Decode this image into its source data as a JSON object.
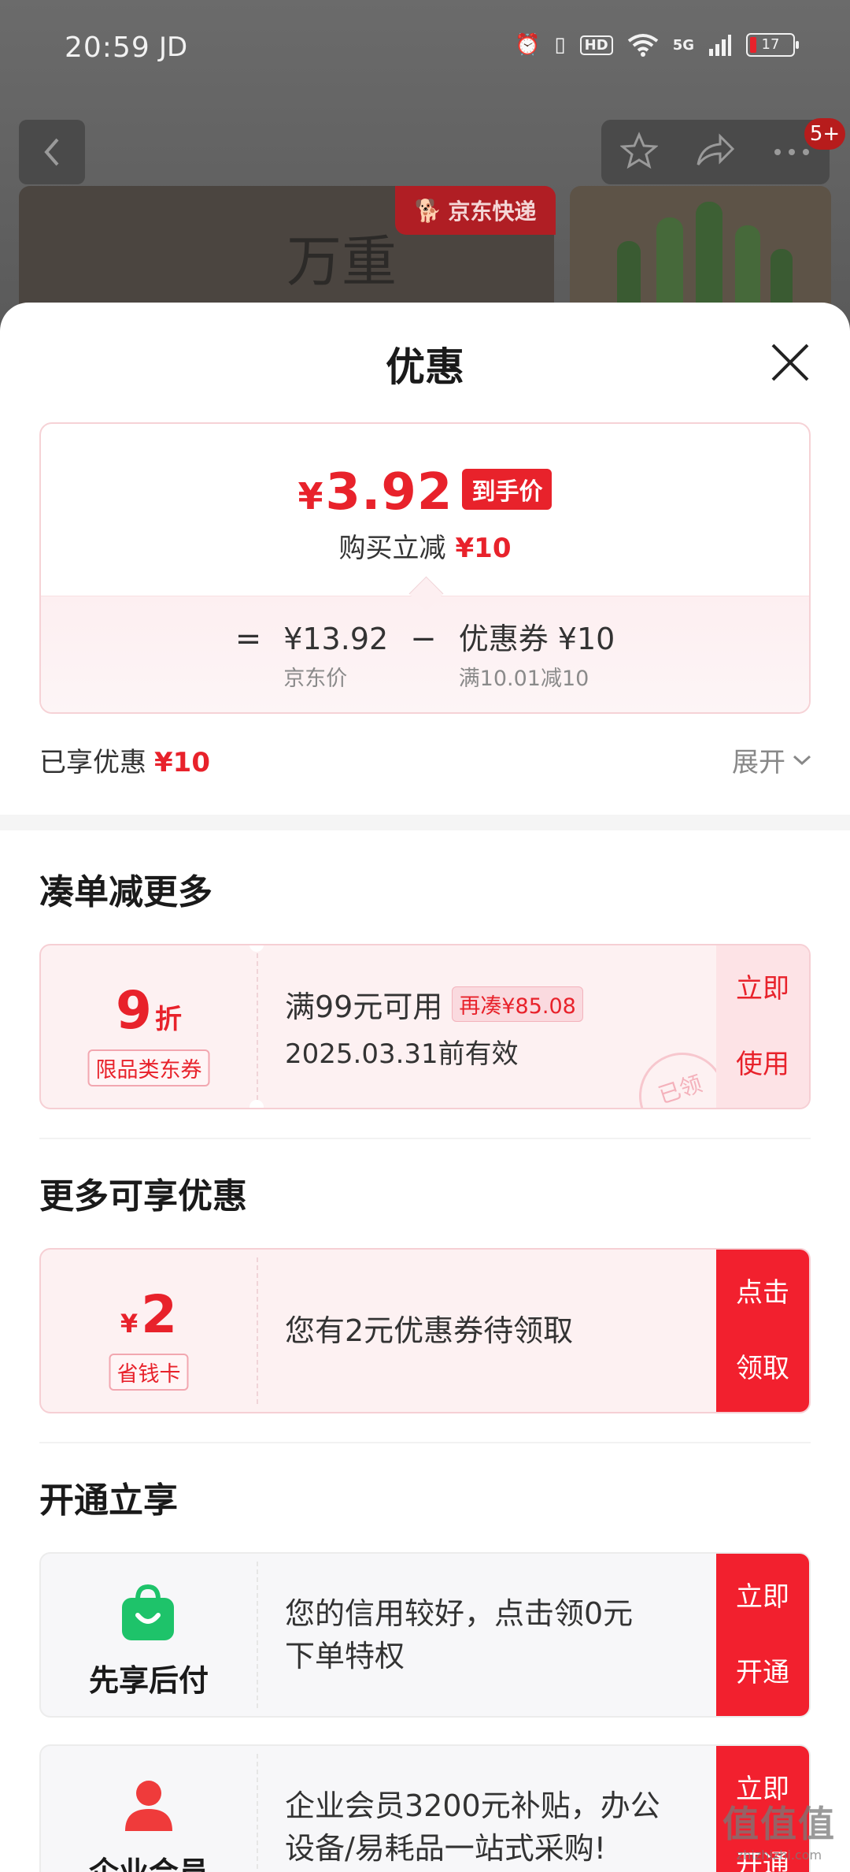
{
  "status_bar": {
    "time": "20:59",
    "app": "JD",
    "hd": "HD",
    "network": "5G",
    "battery": "17"
  },
  "nav": {
    "badge": "5+"
  },
  "background": {
    "jd_express": "京东快递",
    "deco_text": "万重"
  },
  "sheet": {
    "title": "优惠",
    "price_card": {
      "final_price": "3.92",
      "currency": "¥",
      "final_tag": "到手价",
      "buy_text": "购买立减",
      "buy_amount": "¥10",
      "equals": "=",
      "minus": "−",
      "jd_price": "¥13.92",
      "jd_price_label": "京东价",
      "coupon_value": "优惠券 ¥10",
      "coupon_condition": "满10.01减10"
    },
    "saved": {
      "label": "已享优惠",
      "amount": "¥10",
      "expand": "展开"
    },
    "section_more": {
      "title": "凑单减更多",
      "coupon": {
        "discount": "9",
        "discount_unit": "折",
        "tag": "限品类东券",
        "line1": "满99元可用",
        "pill": "再凑¥85.08",
        "line2": "2025.03.31前有效",
        "action_l1": "立即",
        "action_l2": "使用",
        "stamp": "已领"
      }
    },
    "section_enjoy": {
      "title": "更多可享优惠",
      "coupon": {
        "yen": "¥",
        "amount": "2",
        "tag": "省钱卡",
        "text": "您有2元优惠券待领取",
        "action_l1": "点击",
        "action_l2": "领取"
      }
    },
    "section_open": {
      "title": "开通立享",
      "pay_later": {
        "label": "先享后付",
        "line1": "您的信用较好，点击领0元",
        "line2": "下单特权",
        "action_l1": "立即",
        "action_l2": "开通"
      },
      "enterprise": {
        "label": "企业会员",
        "line1": "企业会员3200元补贴，办公",
        "line2": "设备/易耗品一站式采购!",
        "action_l1": "立即",
        "action_l2": "开通"
      }
    }
  },
  "watermark": {
    "logo": "值值值",
    "url": "zhizhizhi.com"
  },
  "colors": {
    "accent_red": "#e8222b",
    "pay_green": "#1ec36a",
    "member_red": "#ef3b3b"
  }
}
